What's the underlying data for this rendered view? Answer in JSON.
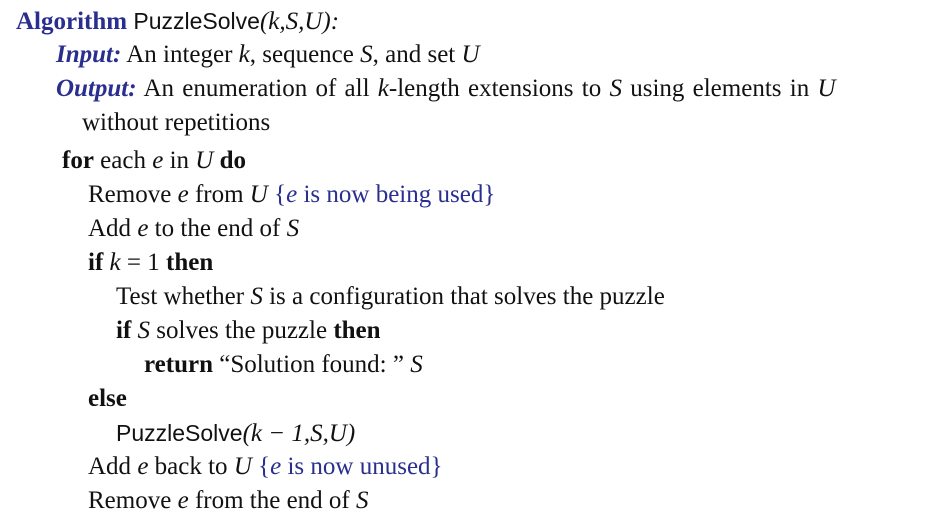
{
  "algorithm": {
    "keyword": "Algorithm",
    "name": "PuzzleSolve",
    "params": "(k,S,U):"
  },
  "io": {
    "input_label": "Input:",
    "input_text_1": "An integer ",
    "input_k": "k",
    "input_text_2": ", sequence ",
    "input_S": "S",
    "input_text_3": ", and set ",
    "input_U": "U",
    "output_label": "Output:",
    "output_text_1": "An enumeration of all ",
    "output_k": "k",
    "output_text_2": "-length extensions to ",
    "output_S": "S",
    "output_text_3": " using elements in ",
    "output_U": "U",
    "output_line2": "without repetitions"
  },
  "body": {
    "for_kw": "for",
    "for_text_1": " each ",
    "for_e": "e",
    "for_text_2": " in ",
    "for_U": "U",
    "do_kw": "do",
    "l_remove_1": "Remove ",
    "l_remove_e": "e",
    "l_remove_2": " from ",
    "l_remove_U": "U",
    "c_used_open": "{",
    "c_used_e": "e",
    "c_used_text": " is now being used",
    "c_used_close": "}",
    "l_add_1": "Add ",
    "l_add_e": "e",
    "l_add_2": " to the end of ",
    "l_add_S": "S",
    "if_kw": "if",
    "if_k": "k",
    "if_cond": " = 1 ",
    "then_kw": "then",
    "l_test_1": "Test whether ",
    "l_test_S": "S",
    "l_test_2": " is a configuration that solves the puzzle",
    "if2_kw": "if",
    "if2_S": "S",
    "if2_text": " solves the puzzle ",
    "then2_kw": "then",
    "return_kw": "return",
    "return_text": " “Solution found: ” ",
    "return_S": "S",
    "else_kw": "else",
    "rec_name": "PuzzleSolve",
    "rec_args": "(k − 1,S,U)",
    "l_addback_1": "Add ",
    "l_addback_e": "e",
    "l_addback_2": " back to ",
    "l_addback_U": "U",
    "c_unused_open": "{",
    "c_unused_e": "e",
    "c_unused_text": " is now unused",
    "c_unused_close": "}",
    "l_removeend_1": "Remove ",
    "l_removeend_e": "e",
    "l_removeend_2": " from the end of ",
    "l_removeend_S": "S"
  },
  "colors": {
    "keyword_blue": "#2a2f8f",
    "text": "#111111"
  }
}
